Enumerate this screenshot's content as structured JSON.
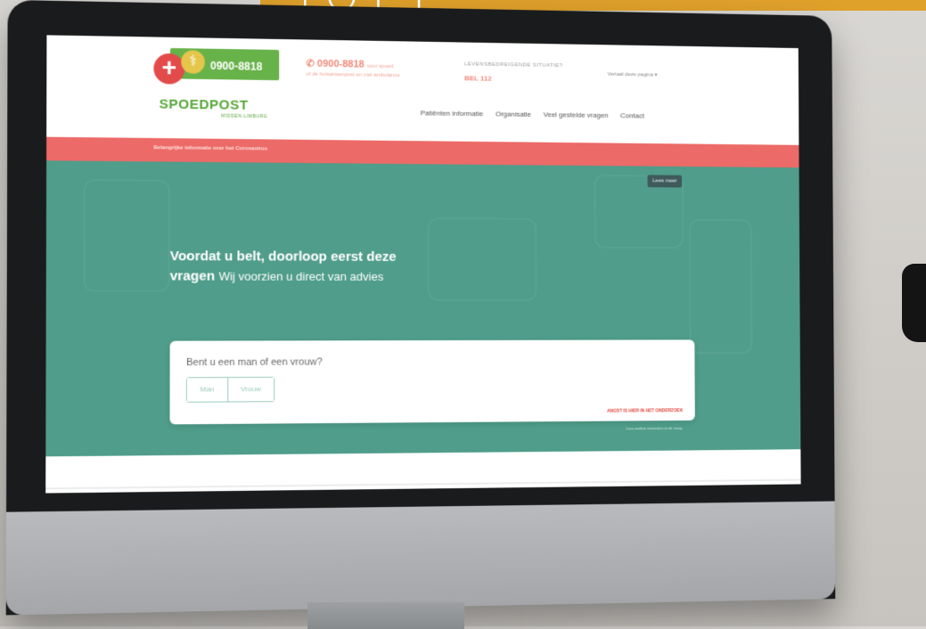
{
  "banner": {
    "partial_text": "JOEI"
  },
  "site": {
    "logo_phone": "0900-8818",
    "brand_name": "SPOEDPOST",
    "brand_sub": "MIDDEN-LIMBURG",
    "header_phone": "0900-8818",
    "header_phone_note": "voor spoed",
    "header_phone_sub": "of de huisartsenpost en niet ambulance",
    "life_threatening_label": "LEVENSBEDREIGENDE SITUATIE?",
    "life_threatening_number": "BEL 112",
    "language_label": "Vertaal deze pagina"
  },
  "nav": {
    "items": [
      "Patiënten informatie",
      "Organisatie",
      "Veel gestelde vragen",
      "Contact"
    ]
  },
  "alert": {
    "text": "Belangrijke informatie over het Coronavirus",
    "button_label": "Lees meer"
  },
  "hero": {
    "title_bold_1": "Voordat u belt, doorloop eerst deze",
    "title_bold_2": "vragen",
    "title_light": "Wij voorzien u direct van advies"
  },
  "questionnaire": {
    "question": "Bent u een man of een vrouw?",
    "options": [
      "Man",
      "Vrouw"
    ],
    "link_label": "ANGST IS HIER IN HET ONDERZOEK",
    "under_note": "Lees verdere instructies na de vraag"
  },
  "colors": {
    "banner": "#e0a12a",
    "alert_bar": "#ec6a67",
    "hero_teal": "#4f9d8a",
    "brand_green": "#59a73b"
  }
}
